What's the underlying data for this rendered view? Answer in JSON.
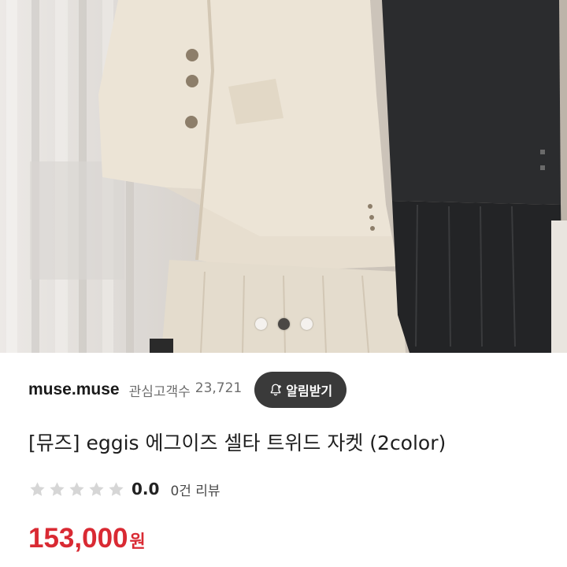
{
  "product_image": {
    "description_icon": "product-photo",
    "carousel": {
      "count": 3,
      "active_index": 1
    }
  },
  "seller": {
    "name": "muse.muse",
    "followers_label": "관심고객수",
    "followers_count": "23,721",
    "notify_button_label": "알림받기"
  },
  "product": {
    "title": "[뮤즈] eggis 에그이즈 셀타 트위드 자켓 (2color)",
    "rating_value": "0.0",
    "review_count": "0건 리뷰",
    "stars_filled": 0,
    "stars_total": 5,
    "price": "153,000",
    "currency": "원"
  },
  "colors": {
    "price": "#d92a33",
    "button_bg": "#3a3a3a",
    "star_empty": "#d6d6d6"
  }
}
